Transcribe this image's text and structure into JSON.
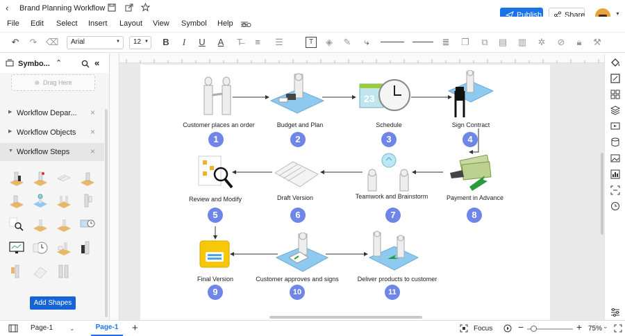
{
  "app": {
    "doc_title": "Brand Planning Workflow",
    "publish_label": "Publish",
    "share_label": "Share"
  },
  "menu": [
    "File",
    "Edit",
    "Select",
    "Insert",
    "Layout",
    "View",
    "Symbol",
    "Help"
  ],
  "toolbar": {
    "font_family": "Arial",
    "font_size": "12"
  },
  "left_panel": {
    "title": "Symbo...",
    "drag_here": "Drag Here",
    "sections": [
      {
        "label": "Workflow Depar...",
        "expanded": false
      },
      {
        "label": "Workflow Objects",
        "expanded": false
      },
      {
        "label": "Workflow Steps",
        "expanded": true
      }
    ],
    "add_shapes_label": "Add Shapes"
  },
  "steps": [
    {
      "num": "1",
      "label": "Customer places an order"
    },
    {
      "num": "2",
      "label": "Budget and Plan"
    },
    {
      "num": "3",
      "label": "Schedule"
    },
    {
      "num": "4",
      "label": "Sign Contract"
    },
    {
      "num": "5",
      "label": "Review and Modify"
    },
    {
      "num": "6",
      "label": "Draft Version"
    },
    {
      "num": "7",
      "label": "Teamwork and Brainstorm"
    },
    {
      "num": "8",
      "label": "Payment in Advance"
    },
    {
      "num": "9",
      "label": "Final Version"
    },
    {
      "num": "10",
      "label": "Customer approves and signs"
    },
    {
      "num": "11",
      "label": "Deliver products to customer"
    }
  ],
  "calendar_day": "23",
  "status": {
    "page_select": "Page-1",
    "active_tab": "Page-1",
    "focus_label": "Focus",
    "zoom": "75%"
  },
  "colors": {
    "accent": "#1a73e8",
    "step_circle": "#6e86e8",
    "add_shapes": "#1565d8",
    "active_tab": "#1a73e8"
  }
}
